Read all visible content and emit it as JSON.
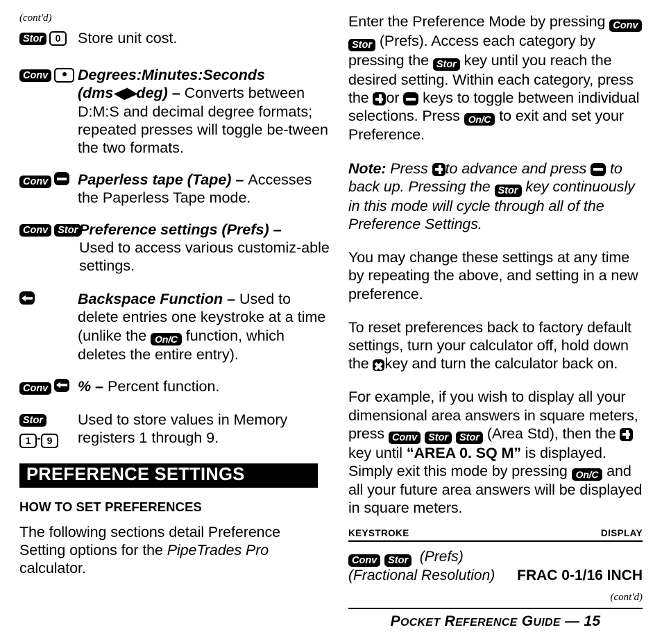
{
  "page": {
    "contd_marker": "(cont'd)",
    "footer": {
      "title_caps": "P",
      "full": "POCKET REFERENCE GUIDE — 15",
      "w1a": "P",
      "w1b": "OCKET",
      "w2a": "R",
      "w2b": "EFERENCE",
      "w3a": "G",
      "w3b": "UIDE",
      "dash_page": "— 15"
    }
  },
  "left_column": {
    "entries": [
      {
        "keys": [
          {
            "type": "black",
            "label": "Stor"
          },
          {
            "type": "white",
            "label": "0"
          }
        ],
        "text": "Store unit cost."
      },
      {
        "keys": [
          {
            "type": "black",
            "label": "Conv"
          },
          {
            "type": "white-dot",
            "label": "."
          }
        ],
        "title": "Degrees:Minutes:Seconds",
        "title_line2": "(dms◀▶deg)",
        "dash": " – ",
        "text": "Converts between D:M:S and decimal degree formats; repeated presses will toggle be-tween the two formats."
      },
      {
        "keys": [
          {
            "type": "black",
            "label": "Conv"
          },
          {
            "type": "symbol",
            "label": "minus-key"
          }
        ],
        "title": "Paperless tape (Tape)",
        "dash": " – ",
        "text": "Accesses the Paperless Tape mode."
      },
      {
        "keys": [
          {
            "type": "black",
            "label": "Conv"
          },
          {
            "type": "black",
            "label": "Stor"
          }
        ],
        "title": "Preference settings (Prefs)",
        "dash": " –",
        "text": "Used to access various customiz-able settings."
      },
      {
        "keys": [
          {
            "type": "symbol",
            "label": "backspace-key"
          }
        ],
        "title": "Backspace Function",
        "dash": " – ",
        "text_a": "Used to delete entries one keystroke at a time (unlike the ",
        "inline_key": "On/C",
        "text_b": " function, which deletes the entire entry)."
      },
      {
        "keys": [
          {
            "type": "black",
            "label": "Conv"
          },
          {
            "type": "symbol",
            "label": "backspace-key"
          }
        ],
        "title": "%",
        "dash": " – ",
        "text": "Percent function."
      },
      {
        "keys": [
          {
            "type": "black",
            "label": "Stor"
          },
          {
            "type": "white",
            "label": "1"
          },
          {
            "type": "sep",
            "label": "-"
          },
          {
            "type": "white",
            "label": "9"
          }
        ],
        "text": "Used to store values in Memory registers 1 through 9."
      }
    ],
    "section_banner": "PREFERENCE SETTINGS",
    "subheading": "HOW TO SET PREFERENCES",
    "intro_a": "The following sections detail Preference Setting options for the ",
    "intro_italic": "PipeTrades Pro",
    "intro_b": " calculator."
  },
  "right_column": {
    "para1": {
      "t1": "Enter the Preference Mode by pressing ",
      "key1": "Conv",
      "key2": "Stor",
      "t2": " (Prefs). Access each category by pressing the ",
      "key3": "Stor",
      "t3": " key until you reach the desired setting. Within each category, press the ",
      "key4": "plus-key",
      "t4": "or ",
      "key5": "minus-key",
      "t5": " keys to toggle between individual selections. Press ",
      "key6": "On/C",
      "t6": " to exit and set your Preference."
    },
    "note": {
      "label": "Note:",
      "t1": " Press ",
      "key1": "plus-key",
      "t2": "to advance and press ",
      "key2": "minus-key",
      "t3": " to back up. Pressing the ",
      "key3": "Stor",
      "t4": " key continuously in this mode will cycle through all of the Preference Settings."
    },
    "para2": "You may change these settings at any time by repeating the above, and setting in a new preference.",
    "para3": {
      "t1": "To reset preferences back to factory default settings, turn your calculator off, hold down the ",
      "key1": "x-key",
      "t2": "key and turn the calculator back on."
    },
    "para4": {
      "t1": "For example, if you wish to display all your dimensional area answers in square meters, press ",
      "key1": "Conv",
      "key2": "Stor",
      "key3": "Stor",
      "t2": " (Area Std), then the ",
      "key4": "plus-key",
      "t3": " key until ",
      "quoted": "“AREA 0. SQ M”",
      "t4": " is displayed. Simply exit this mode by pressing ",
      "key5": "On/C",
      "t5": " and all your future area answers will be displayed in square meters."
    },
    "table": {
      "header_left": "KEYSTROKE",
      "header_right": "DISPLAY",
      "rows": [
        {
          "keys": [
            "Conv",
            "Stor"
          ],
          "ks_note": "(Prefs)",
          "ks_line2": "(Fractional Resolution)",
          "display": "FRAC  0-1/16 INCH"
        }
      ],
      "contd": "(cont'd)"
    }
  }
}
